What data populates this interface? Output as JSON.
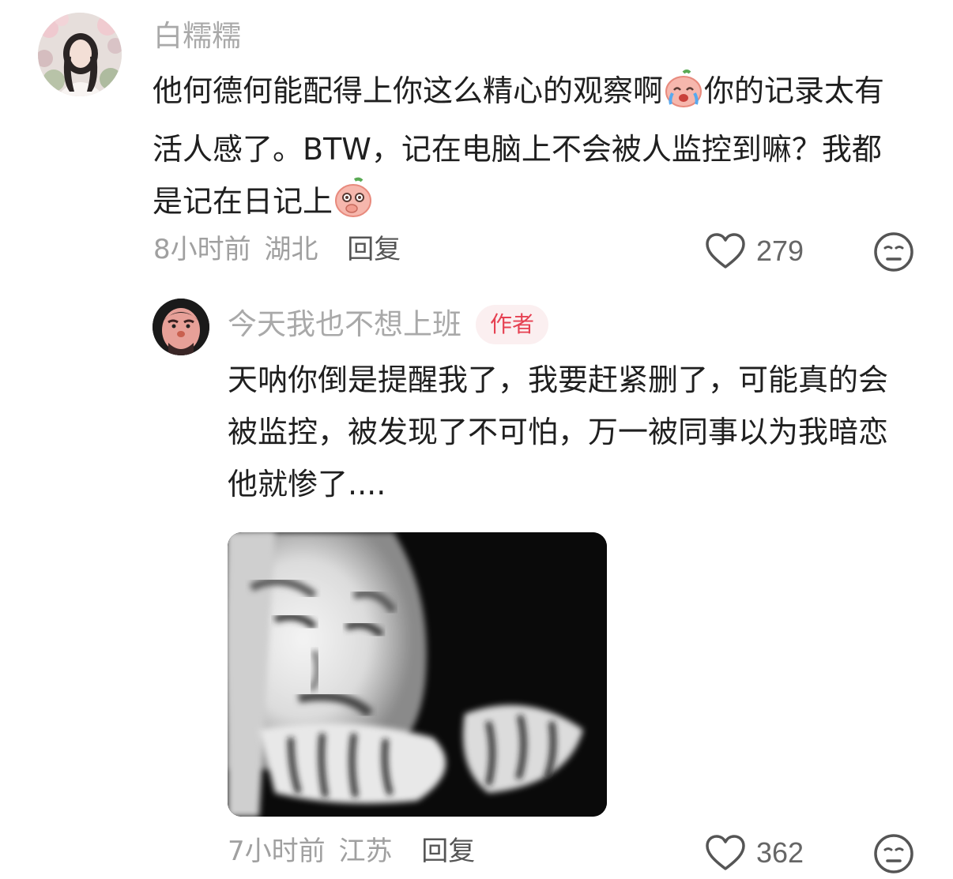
{
  "comment": {
    "username": "白糯糯",
    "text_1": "他何德何能配得上你这么精心的观察啊",
    "emoji_1": "crying-laugh-peach-emoji",
    "text_2": "你的记录太有活人感了。BTW，记在电脑上不会被人监控到嘛？我都是记在日记上",
    "emoji_2": "shy-peach-emoji",
    "time": "8小时前",
    "location": "湖北",
    "reply_label": "回复",
    "likes": "279"
  },
  "reply": {
    "username": "今天我也不想上班",
    "badge": "作者",
    "text": "天呐你倒是提醒我了，我要赶紧删了，可能真的会被监控，被发现了不可怕，万一被同事以为我暗恋他就惨了....",
    "image": "meme-image",
    "time": "7小时前",
    "location": "江苏",
    "reply_label": "回复",
    "likes": "362"
  },
  "colors": {
    "badge_bg": "#fbeff0",
    "badge_text": "#e64152",
    "muted": "#a0a0a0"
  }
}
